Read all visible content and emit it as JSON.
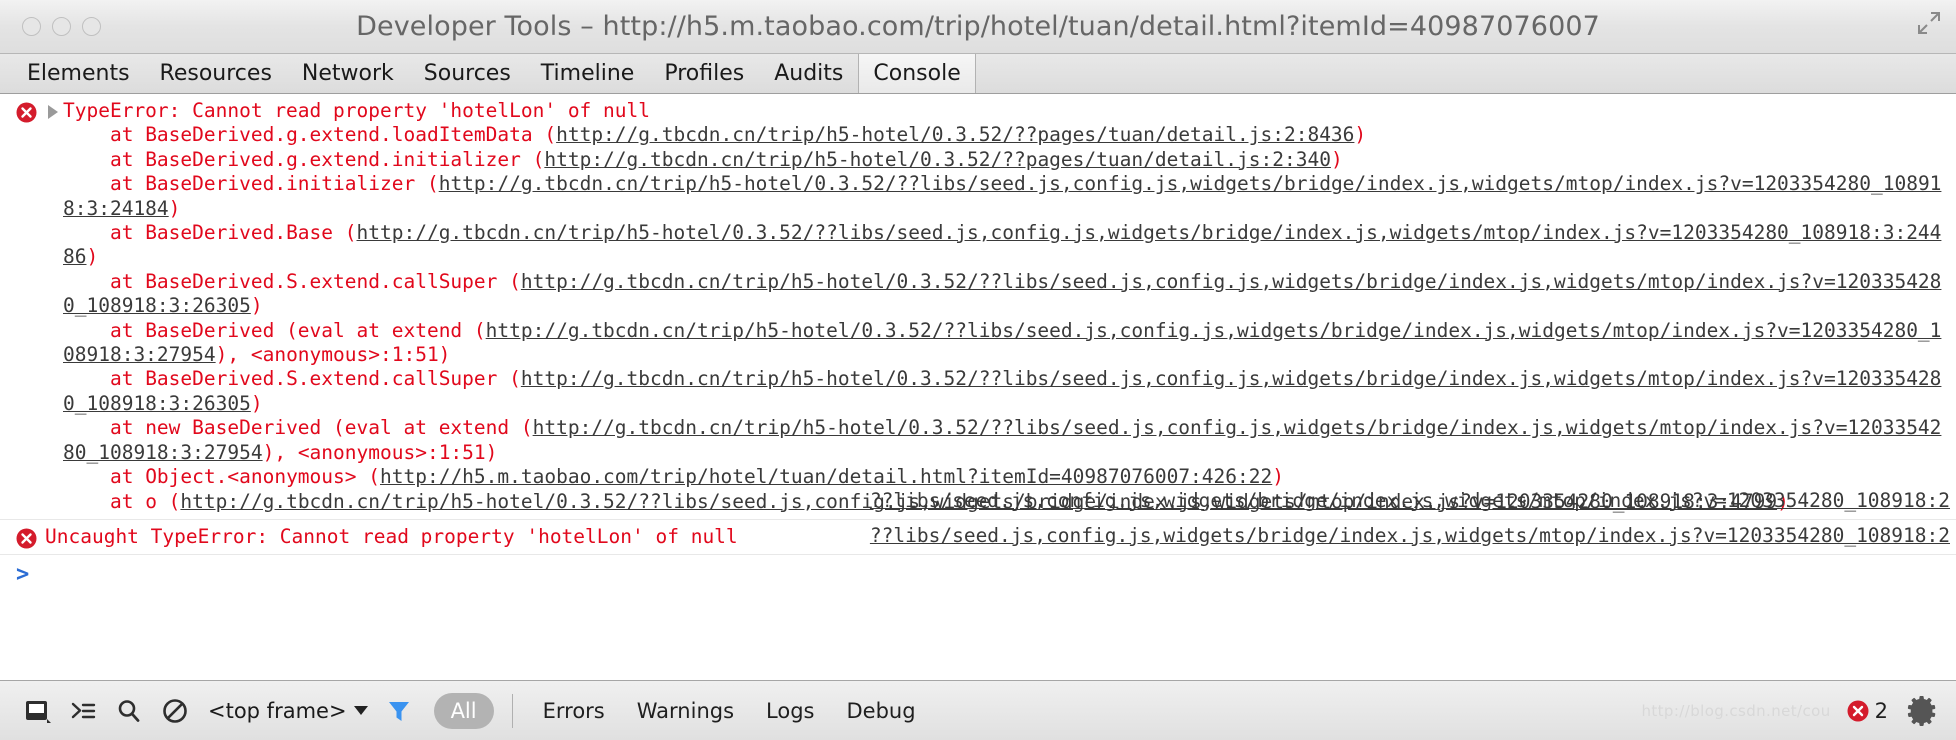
{
  "window": {
    "title": "Developer Tools – http://h5.m.taobao.com/trip/hotel/tuan/detail.html?itemId=40987076007",
    "traffic_lights": [
      "close",
      "minimize",
      "zoom"
    ],
    "resize_icon": "resize-diagonal-icon"
  },
  "tabs": [
    {
      "label": "Elements",
      "selected": false
    },
    {
      "label": "Resources",
      "selected": false
    },
    {
      "label": "Network",
      "selected": false
    },
    {
      "label": "Sources",
      "selected": false
    },
    {
      "label": "Timeline",
      "selected": false
    },
    {
      "label": "Profiles",
      "selected": false
    },
    {
      "label": "Audits",
      "selected": false
    },
    {
      "label": "Console",
      "selected": true
    }
  ],
  "console": {
    "messages": [
      {
        "level": "error",
        "expandable": true,
        "header": "TypeError: Cannot read property 'hotelLon' of null",
        "stack": [
          {
            "fn": "    at BaseDerived.g.extend.loadItemData (",
            "url": "http://g.tbcdn.cn/trip/h5-hotel/0.3.52/??pages/tuan/detail.js:2:8436",
            "close": ")"
          },
          {
            "fn": "    at BaseDerived.g.extend.initializer (",
            "url": "http://g.tbcdn.cn/trip/h5-hotel/0.3.52/??pages/tuan/detail.js:2:340",
            "close": ")"
          },
          {
            "fn": "    at BaseDerived.initializer (",
            "url": "http://g.tbcdn.cn/trip/h5-hotel/0.3.52/??libs/seed.js,config.js,widgets/bridge/index.js,widgets/mtop/index.js?v=1203354280_108918:3:24184",
            "close": ")"
          },
          {
            "fn": "    at BaseDerived.Base (",
            "url": "http://g.tbcdn.cn/trip/h5-hotel/0.3.52/??libs/seed.js,config.js,widgets/bridge/index.js,widgets/mtop/index.js?v=1203354280_108918:3:24486",
            "close": ")"
          },
          {
            "fn": "    at BaseDerived.S.extend.callSuper (",
            "url": "http://g.tbcdn.cn/trip/h5-hotel/0.3.52/??libs/seed.js,config.js,widgets/bridge/index.js,widgets/mtop/index.js?v=1203354280_108918:3:26305",
            "close": ")"
          },
          {
            "fn": "    at BaseDerived (eval at extend (",
            "url": "http://g.tbcdn.cn/trip/h5-hotel/0.3.52/??libs/seed.js,config.js,widgets/bridge/index.js,widgets/mtop/index.js?v=1203354280_108918:3:27954",
            "close": "), <anonymous>:1:51)"
          },
          {
            "fn": "    at BaseDerived.S.extend.callSuper (",
            "url": "http://g.tbcdn.cn/trip/h5-hotel/0.3.52/??libs/seed.js,config.js,widgets/bridge/index.js,widgets/mtop/index.js?v=1203354280_108918:3:26305",
            "close": ")"
          },
          {
            "fn": "    at new BaseDerived (eval at extend (",
            "url": "http://g.tbcdn.cn/trip/h5-hotel/0.3.52/??libs/seed.js,config.js,widgets/bridge/index.js,widgets/mtop/index.js?v=1203354280_108918:3:27954",
            "close": "), <anonymous>:1:51)"
          },
          {
            "fn": "    at Object.<anonymous> (",
            "url": "http://h5.m.taobao.com/trip/hotel/tuan/detail.html?itemId=40987076007:426:22",
            "close": ")"
          },
          {
            "fn": "    at o (",
            "url": "http://g.tbcdn.cn/trip/h5-hotel/0.3.52/??libs/seed.js,config.js,widgets/bridge/index.js,widgets/mtop/index.js?v=1203354280_108918:3:4799",
            "close": ")"
          }
        ],
        "source_link": "??libs/seed.js,config.js,widgets/bridge/index.js,widgets/mtop/index.js?v=1203354280_108918:2"
      },
      {
        "level": "error",
        "expandable": false,
        "header": "Uncaught TypeError: Cannot read property 'hotelLon' of null",
        "stack": [],
        "source_link": "??libs/seed.js,config.js,widgets/bridge/index.js,widgets/mtop/index.js?v=1203354280_108918:2"
      }
    ],
    "prompt": ">"
  },
  "toolbar": {
    "dock_icon": "dock-window-icon",
    "drawer_icon": "show-drawer-icon",
    "search_icon": "search-icon",
    "clear_icon": "clear-console-icon",
    "frame_selector": "<top frame>",
    "filter_icon": "filter-funnel-icon",
    "filters": [
      {
        "label": "All",
        "selected": true
      },
      {
        "label": "Errors",
        "selected": false
      },
      {
        "label": "Warnings",
        "selected": false
      },
      {
        "label": "Logs",
        "selected": false
      },
      {
        "label": "Debug",
        "selected": false
      }
    ],
    "watermark": "http://blog.csdn.net/cou",
    "error_badge": {
      "icon": "error-circle-icon",
      "count": "2"
    },
    "settings_icon": "gear-icon"
  },
  "colors": {
    "error_red": "#e1081c",
    "link_gray": "#3a3a3a",
    "accent_blue": "#2b6cd4",
    "pill_gray": "#b3b3b3"
  }
}
